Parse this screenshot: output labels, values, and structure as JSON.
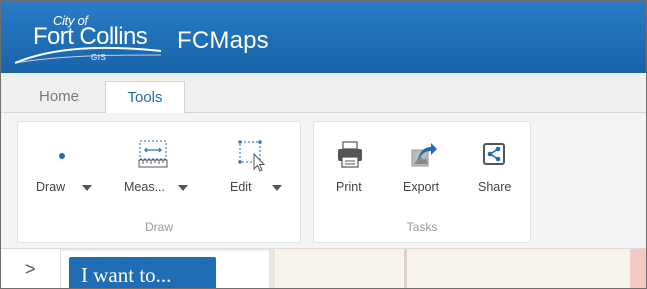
{
  "header": {
    "logo": {
      "city_of": "City of",
      "fort_collins": "Fort Collins",
      "gis": "GIS"
    },
    "app_title": "FCMaps",
    "background_color": "#1e6db5"
  },
  "tabs": [
    {
      "label": "Home",
      "active": false
    },
    {
      "label": "Tools",
      "active": true
    }
  ],
  "ribbon": {
    "groups": {
      "draw": {
        "label": "Draw",
        "tools": [
          {
            "label": "Draw",
            "icon": "point-icon",
            "dropdown": true
          },
          {
            "label": "Meas...",
            "icon": "measure-icon",
            "dropdown": true
          },
          {
            "label": "Edit",
            "icon": "edit-select-icon",
            "dropdown": true
          }
        ]
      },
      "tasks": {
        "label": "Tasks",
        "tools": [
          {
            "label": "Print",
            "icon": "printer-icon"
          },
          {
            "label": "Export",
            "icon": "export-icon"
          },
          {
            "label": "Share",
            "icon": "share-icon"
          }
        ]
      }
    }
  },
  "bottom": {
    "expand_icon": "chevron-right-icon",
    "expand_glyph": ">",
    "i_want_to": "I want to..."
  },
  "colors": {
    "accent": "#1e6db5",
    "icon_blue": "#1e6db5",
    "icon_gray": "#555555"
  }
}
